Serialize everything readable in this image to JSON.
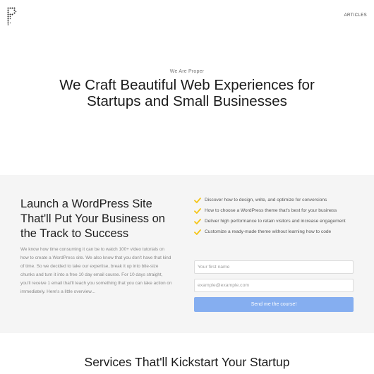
{
  "nav": {
    "articles_label": "ARTICLES"
  },
  "hero": {
    "eyebrow": "We Are Proper",
    "title_line1": "We Craft Beautiful Web Experiences for",
    "title_line2": "Startups and Small Businesses"
  },
  "course": {
    "heading_line1": "Launch a WordPress Site",
    "heading_line2": "That'll Put Your Business on",
    "heading_line3": "the Track to Success",
    "description": "We know how time consuming it can be to watch 100+ video tutorials on how to create a WordPress site. We also know that you don't have that kind of time. So we decided to take our expertise, break it up into bite-size chunks and turn it into a free 10 day email course. For 10 days straight, you'll receive 1 email that'll teach you something that you can take action on immediately. Here's a little overview...",
    "benefits": [
      "Discover how to design, write, and optimize for conversions",
      "How to choose a WordPress theme that's best for your business",
      "Deliver high performance to retain visitors and increase engagement",
      "Customize a ready-made theme without learning how to code"
    ],
    "form": {
      "name_placeholder": "Your first name",
      "name_value": "",
      "email_placeholder": "example@example.com",
      "email_value": "",
      "submit_label": "Send me the course!"
    },
    "icons": {
      "benefit_icon": "check-icon"
    },
    "colors": {
      "check": "#f5c518",
      "button": "#85aef0",
      "section_bg": "#f5f5f5"
    }
  },
  "services": {
    "title": "Services That'll Kickstart Your Startup"
  }
}
